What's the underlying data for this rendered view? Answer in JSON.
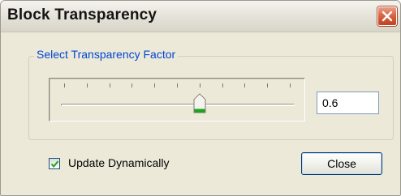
{
  "window": {
    "title": "Block Transparency"
  },
  "group": {
    "legend": "Select Transparency Factor"
  },
  "slider": {
    "value": 0.6,
    "min": 0,
    "max": 1,
    "tick_count": 11
  },
  "value_field": {
    "value": "0.6"
  },
  "update_dynamically": {
    "label": "Update Dynamically",
    "checked": true
  },
  "buttons": {
    "close_label": "Close"
  },
  "colors": {
    "legend_text": "#0046d5",
    "close_button_red": "#d8603d",
    "checkmark_green": "#21a121",
    "thumb_accent": "#21a121"
  },
  "icons": {
    "close": "close-x-icon",
    "checkmark": "checkmark-icon",
    "slider_thumb": "slider-thumb-icon"
  }
}
